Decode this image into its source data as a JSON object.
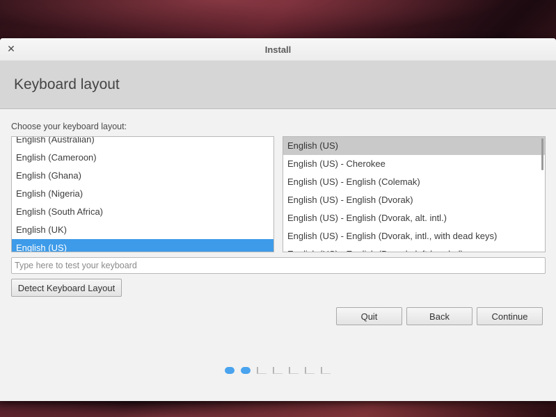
{
  "window": {
    "title": "Install",
    "close_glyph": "✕"
  },
  "header": {
    "title": "Keyboard layout"
  },
  "prompt": "Choose your keyboard layout:",
  "layouts": [
    "English (Australian)",
    "English (Cameroon)",
    "English (Ghana)",
    "English (Nigeria)",
    "English (South Africa)",
    "English (UK)",
    "English (US)"
  ],
  "selected_layout": "English (US)",
  "variants": [
    "English (US)",
    "English (US) - Cherokee",
    "English (US) - English (Colemak)",
    "English (US) - English (Dvorak)",
    "English (US) - English (Dvorak, alt. intl.)",
    "English (US) - English (Dvorak, intl., with dead keys)",
    "English (US) - English (Dvorak, left-handed)"
  ],
  "selected_variant": "English (US)",
  "test_input": {
    "placeholder": "Type here to test your keyboard",
    "value": ""
  },
  "buttons": {
    "detect": "Detect Keyboard Layout",
    "quit": "Quit",
    "back": "Back",
    "continue": "Continue"
  },
  "progress": {
    "total_steps": 7,
    "completed_steps": 2
  },
  "colors": {
    "selection_blue": "#3d9be9",
    "selection_gray": "#c9c9c9",
    "progress_done": "#4aa3ee"
  }
}
